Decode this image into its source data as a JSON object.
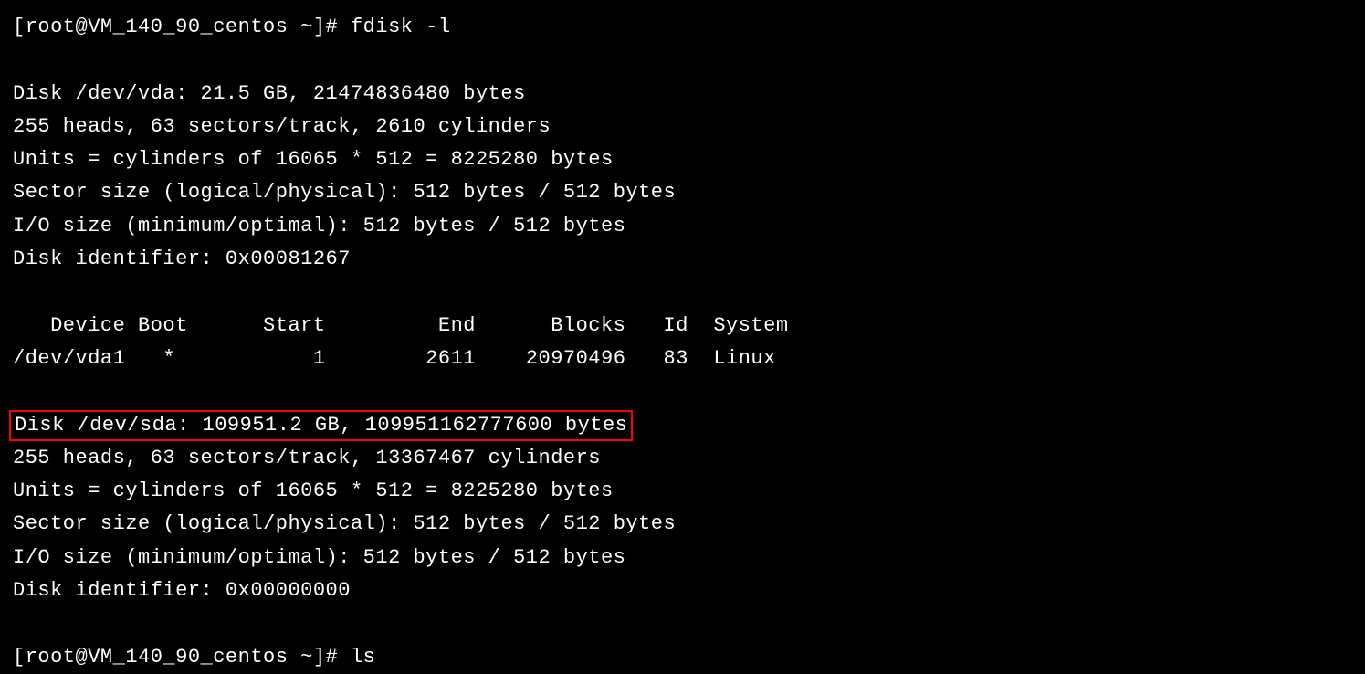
{
  "terminal": {
    "prompt1": "[root@VM_140_90_centos ~]# ",
    "command1": "fdisk -l",
    "disk1": {
      "line1": "Disk /dev/vda: 21.5 GB, 21474836480 bytes",
      "line2": "255 heads, 63 sectors/track, 2610 cylinders",
      "line3": "Units = cylinders of 16065 * 512 = 8225280 bytes",
      "line4": "Sector size (logical/physical): 512 bytes / 512 bytes",
      "line5": "I/O size (minimum/optimal): 512 bytes / 512 bytes",
      "line6": "Disk identifier: 0x00081267"
    },
    "partition_table": {
      "header": "   Device Boot      Start         End      Blocks   Id  System",
      "row1": "/dev/vda1   *           1        2611    20970496   83  Linux"
    },
    "disk2": {
      "line1": "Disk /dev/sda: 109951.2 GB, 109951162777600 bytes",
      "line2": "255 heads, 63 sectors/track, 13367467 cylinders",
      "line3": "Units = cylinders of 16065 * 512 = 8225280 bytes",
      "line4": "Sector size (logical/physical): 512 bytes / 512 bytes",
      "line5": "I/O size (minimum/optimal): 512 bytes / 512 bytes",
      "line6": "Disk identifier: 0x00000000"
    },
    "prompt2": "[root@VM_140_90_centos ~]# ",
    "command2": "ls"
  }
}
